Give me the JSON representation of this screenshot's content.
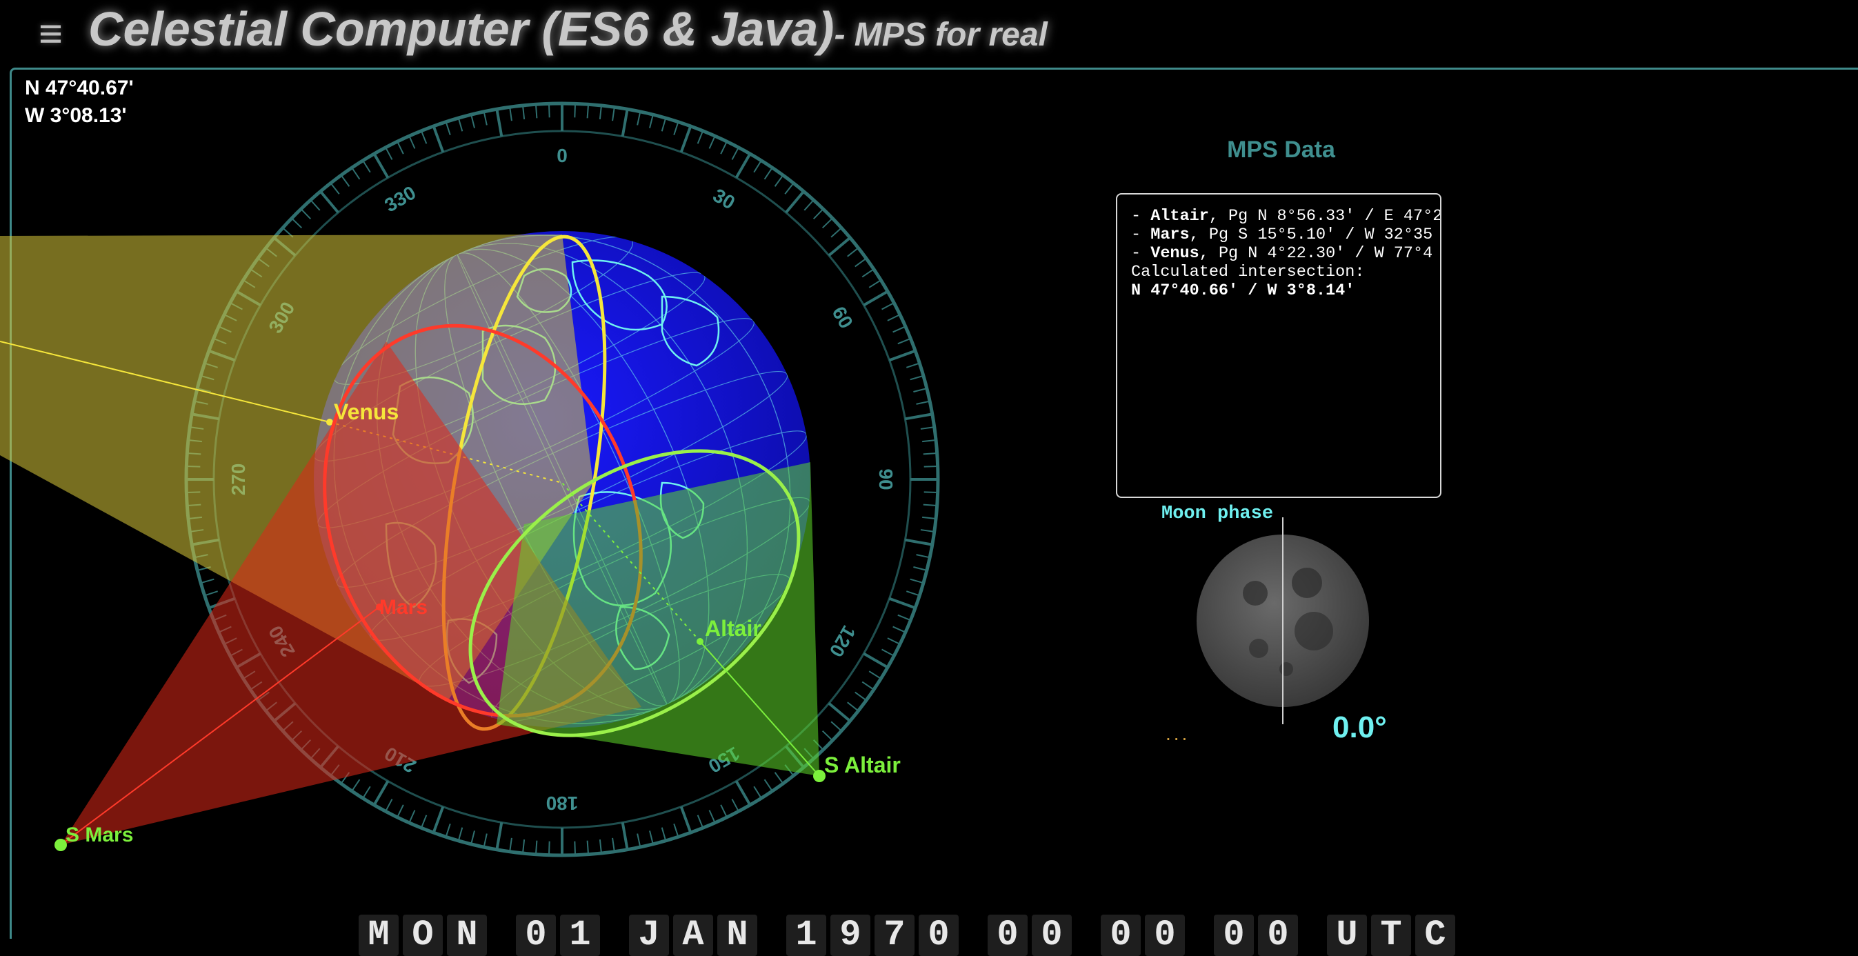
{
  "header": {
    "menu_icon": "≡",
    "title_main": "Celestial Computer (ES6 & Java)",
    "title_sub": "- MPS for real"
  },
  "position": {
    "latitude": "N 47°40.67'",
    "longitude": "W 3°08.13'"
  },
  "globe": {
    "compass_labels": [
      "0",
      "30",
      "60",
      "90",
      "120",
      "150",
      "180",
      "210",
      "240",
      "270",
      "300",
      "330"
    ],
    "bodies": [
      {
        "name": "Venus",
        "color": "#f5e63b"
      },
      {
        "name": "Mars",
        "color": "#ff3a2a"
      },
      {
        "name": "Altair",
        "color": "#7cf03c"
      }
    ],
    "subpoints": [
      {
        "label": "S Altair",
        "color": "#7cf03c"
      },
      {
        "label": "S Mars",
        "color": "#7cf03c"
      }
    ],
    "colors": {
      "ocean": "#1010d8",
      "coast": "#6ff0f0",
      "ring": "#2f6f6f"
    }
  },
  "mps": {
    "title": "MPS Data",
    "lines": [
      {
        "prefix": "- ",
        "name": "Altair",
        "rest": ", Pg N 8°56.33' / E 47°2"
      },
      {
        "prefix": "- ",
        "name": "Mars",
        "rest": ", Pg S 15°5.10' / W 32°35"
      },
      {
        "prefix": "- ",
        "name": "Venus",
        "rest": ", Pg N 4°22.30' / W 77°4"
      }
    ],
    "intersection_label": "Calculated intersection:",
    "intersection_value": "N 47°40.66' / W 3°8.14'"
  },
  "moon": {
    "label": "Moon phase",
    "dots": "...",
    "value": "0.0°"
  },
  "datetime": {
    "chars": [
      "M",
      "O",
      "N",
      ":",
      "0",
      "1",
      ":",
      "J",
      "A",
      "N",
      ":",
      "1",
      "9",
      "7",
      "0",
      ":",
      "0",
      "0",
      ":",
      "0",
      "0",
      ":",
      "0",
      "0",
      ":",
      "U",
      "T",
      "C"
    ]
  }
}
